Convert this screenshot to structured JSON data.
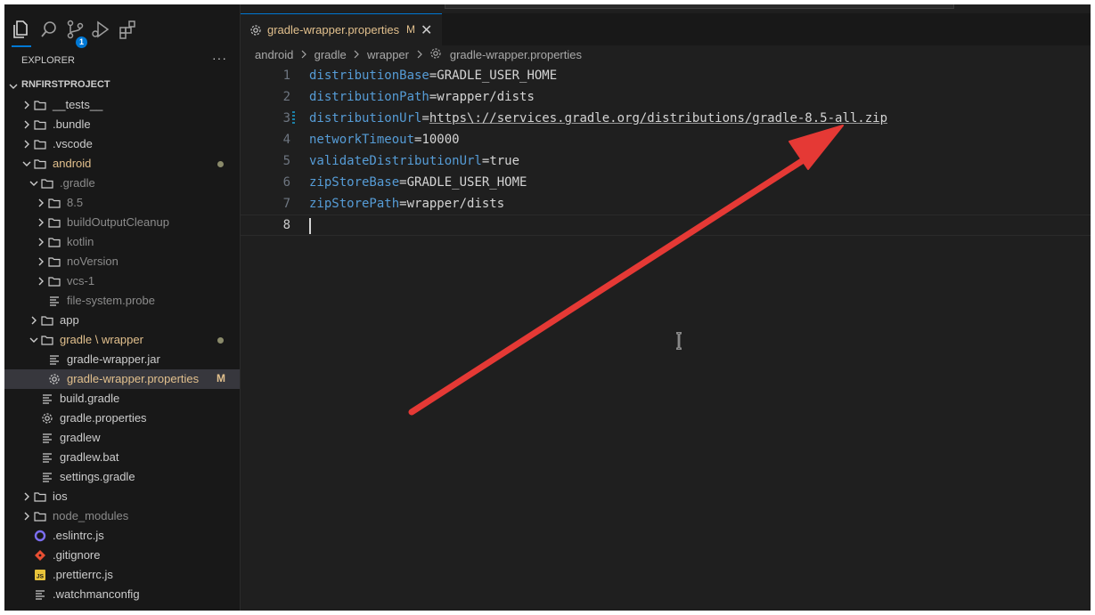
{
  "sidebar": {
    "activity_icons": [
      "files-icon",
      "search-icon",
      "source-control-icon",
      "run-debug-icon",
      "extensions-icon"
    ],
    "source_control_badge": "1",
    "explorer_title": "EXPLORER",
    "more_actions": "···",
    "project_name": "RNFIRSTPROJECT",
    "tree": [
      {
        "label": "__tests__",
        "kind": "folder",
        "state": "collapsed",
        "depth": 1
      },
      {
        "label": ".bundle",
        "kind": "folder",
        "state": "collapsed",
        "depth": 1
      },
      {
        "label": ".vscode",
        "kind": "folder",
        "state": "collapsed",
        "depth": 1
      },
      {
        "label": "android",
        "kind": "folder",
        "state": "expanded",
        "depth": 1,
        "modified": true
      },
      {
        "label": ".gradle",
        "kind": "folder",
        "state": "expanded",
        "depth": 2,
        "dim": true
      },
      {
        "label": "8.5",
        "kind": "folder",
        "state": "collapsed",
        "depth": 3,
        "dim": true
      },
      {
        "label": "buildOutputCleanup",
        "kind": "folder",
        "state": "collapsed",
        "depth": 3,
        "dim": true
      },
      {
        "label": "kotlin",
        "kind": "folder",
        "state": "collapsed",
        "depth": 3,
        "dim": true
      },
      {
        "label": "noVersion",
        "kind": "folder",
        "state": "collapsed",
        "depth": 3,
        "dim": true
      },
      {
        "label": "vcs-1",
        "kind": "folder",
        "state": "collapsed",
        "depth": 3,
        "dim": true
      },
      {
        "label": "file-system.probe",
        "kind": "file",
        "depth": 3,
        "dim": true
      },
      {
        "label": "app",
        "kind": "folder",
        "state": "collapsed",
        "depth": 2
      },
      {
        "label": "gradle \\ wrapper",
        "kind": "folder",
        "state": "expanded",
        "depth": 2,
        "modified": true
      },
      {
        "label": "gradle-wrapper.jar",
        "kind": "file",
        "depth": 3
      },
      {
        "label": "gradle-wrapper.properties",
        "kind": "gear",
        "depth": 3,
        "modified": true,
        "selected": true,
        "flag": "M"
      },
      {
        "label": "build.gradle",
        "kind": "file",
        "depth": 2
      },
      {
        "label": "gradle.properties",
        "kind": "gear",
        "depth": 2
      },
      {
        "label": "gradlew",
        "kind": "file",
        "depth": 2
      },
      {
        "label": "gradlew.bat",
        "kind": "file",
        "depth": 2
      },
      {
        "label": "settings.gradle",
        "kind": "file",
        "depth": 2
      },
      {
        "label": "ios",
        "kind": "folder",
        "state": "collapsed",
        "depth": 1
      },
      {
        "label": "node_modules",
        "kind": "folder",
        "state": "collapsed",
        "depth": 1,
        "dim": true
      },
      {
        "label": ".eslintrc.js",
        "kind": "eslint",
        "depth": 1
      },
      {
        "label": ".gitignore",
        "kind": "git",
        "depth": 1
      },
      {
        "label": ".prettierrc.js",
        "kind": "js",
        "depth": 1
      },
      {
        "label": ".watchmanconfig",
        "kind": "file",
        "depth": 1
      }
    ]
  },
  "tab": {
    "name": "gradle-wrapper.properties",
    "modified_flag": "M",
    "close_glyph": "✕"
  },
  "breadcrumb": {
    "parts": [
      "android",
      "gradle",
      "wrapper",
      "gradle-wrapper.properties"
    ]
  },
  "editor": {
    "lines": [
      {
        "n": "1",
        "key": "distributionBase",
        "value": "GRADLE_USER_HOME"
      },
      {
        "n": "2",
        "key": "distributionPath",
        "value": "wrapper/dists"
      },
      {
        "n": "3",
        "key": "distributionUrl",
        "value": "https\\://services.gradle.org/distributions/gradle-8.5-all.zip",
        "url": true,
        "gutter_modified": true
      },
      {
        "n": "4",
        "key": "networkTimeout",
        "value": "10000"
      },
      {
        "n": "5",
        "key": "validateDistributionUrl",
        "value": "true"
      },
      {
        "n": "6",
        "key": "zipStoreBase",
        "value": "GRADLE_USER_HOME"
      },
      {
        "n": "7",
        "key": "zipStorePath",
        "value": "wrapper/dists"
      },
      {
        "n": "8",
        "key": "",
        "value": "",
        "current": true
      }
    ]
  },
  "annotation": {
    "arrow_color": "#e53935"
  },
  "colors": {
    "accent": "#0078d4",
    "modified": "#e2c08d",
    "key": "#569cd6"
  }
}
